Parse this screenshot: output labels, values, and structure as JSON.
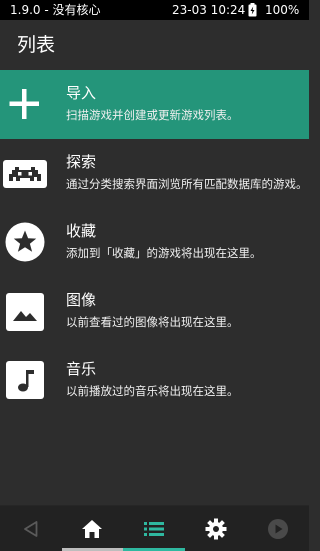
{
  "status_bar": {
    "left_text": "1.9.0 - 没有核心",
    "time": "23-03 10:24",
    "battery_pct": "100%",
    "battery_icon": "battery-charging-icon"
  },
  "header": {
    "title": "列表"
  },
  "items": [
    {
      "label": "导入",
      "sub": "扫描游戏并创建或更新游戏列表。",
      "icon": "plus-icon",
      "selected": true
    },
    {
      "label": "探索",
      "sub": "通过分类搜索界面浏览所有匹配数据库的游戏。",
      "icon": "retroarch-invader-icon",
      "selected": false
    },
    {
      "label": "收藏",
      "sub": "添加到「收藏」的游戏将出现在这里。",
      "icon": "star-icon",
      "selected": false
    },
    {
      "label": "图像",
      "sub": "以前查看过的图像将出现在这里。",
      "icon": "image-icon",
      "selected": false
    },
    {
      "label": "音乐",
      "sub": "以前播放过的音乐将出现在这里。",
      "icon": "music-note-icon",
      "selected": false
    }
  ],
  "bottom_nav": [
    {
      "icon": "back-icon",
      "active": false
    },
    {
      "icon": "home-icon",
      "active": false
    },
    {
      "icon": "list-icon",
      "active": true
    },
    {
      "icon": "settings-gear-icon",
      "active": false
    },
    {
      "icon": "play-icon",
      "active": false
    }
  ],
  "colors": {
    "accent": "#24957a",
    "active_nav_indicator": "#2fb8a0",
    "background": "#2d2d2d"
  }
}
